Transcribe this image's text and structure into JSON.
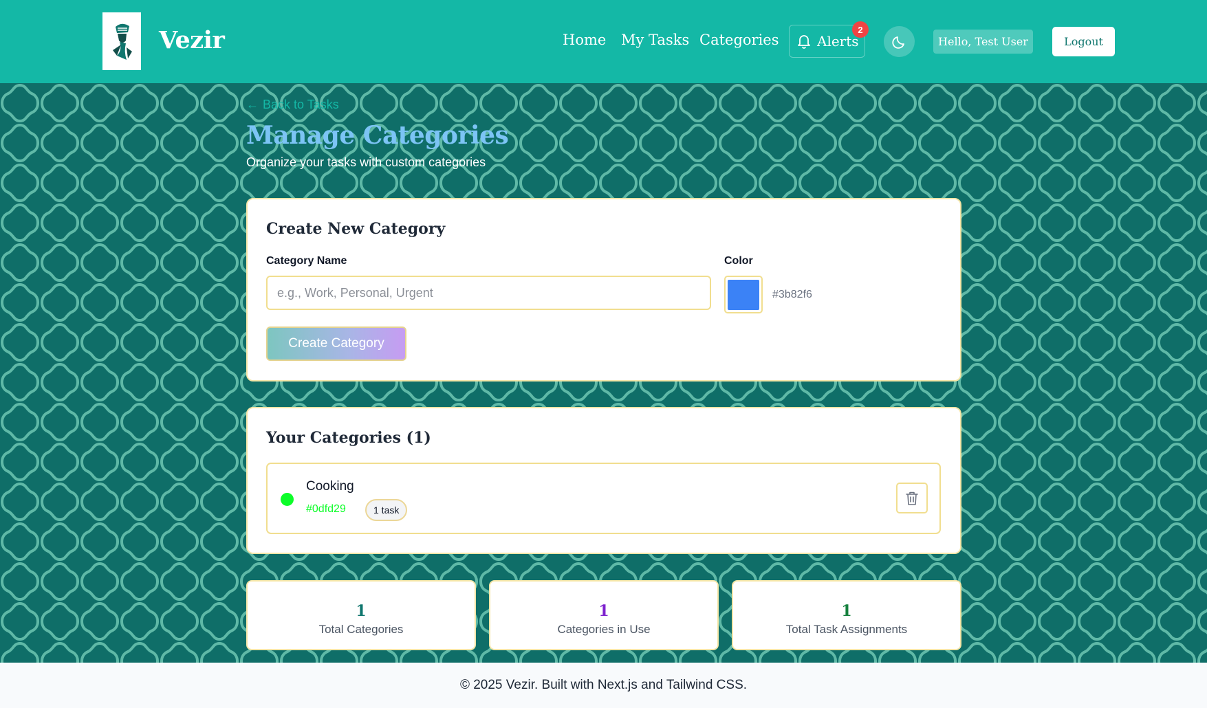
{
  "header": {
    "brand": "Vezir",
    "nav": [
      "Home",
      "My Tasks",
      "Categories"
    ],
    "alerts_label": "Alerts",
    "alerts_count": "2",
    "greeting": "Hello, Test User",
    "logout_label": "Logout"
  },
  "page": {
    "back_label": "Back to Tasks",
    "title": "Manage Categories",
    "subtitle": "Organize your tasks with custom categories"
  },
  "create_form": {
    "title": "Create New Category",
    "name_label": "Category Name",
    "name_placeholder": "e.g., Work, Personal, Urgent",
    "name_value": "",
    "color_label": "Color",
    "color_value": "#3b82f6",
    "submit_label": "Create Category"
  },
  "categories": {
    "title": "Your Categories (1)",
    "items": [
      {
        "name": "Cooking",
        "color": "#0dfd29",
        "task_count": "1 task"
      }
    ]
  },
  "stats": [
    {
      "value": "1",
      "label": "Total Categories",
      "color": "#0f766e"
    },
    {
      "value": "1",
      "label": "Categories in Use",
      "color": "#7e22ce"
    },
    {
      "value": "1",
      "label": "Total Task Assignments",
      "color": "#15803d"
    }
  ],
  "footer": {
    "text": "© 2025 Vezir. Built with Next.js and Tailwind CSS."
  }
}
